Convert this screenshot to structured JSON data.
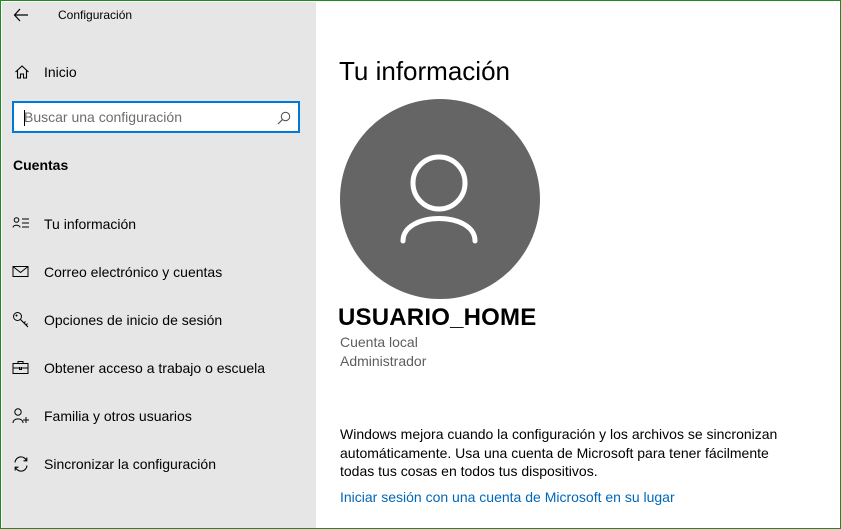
{
  "titlebar": {
    "title": "Configuración",
    "back_icon": "back-arrow-icon"
  },
  "sidebar": {
    "home_label": "Inicio",
    "search_placeholder": "Buscar una configuración",
    "section_title": "Cuentas",
    "items": [
      {
        "label": "Tu información",
        "icon": "person-card-icon"
      },
      {
        "label": "Correo electrónico y cuentas",
        "icon": "mail-icon"
      },
      {
        "label": "Opciones de inicio de sesión",
        "icon": "key-icon"
      },
      {
        "label": "Obtener acceso a trabajo o escuela",
        "icon": "briefcase-icon"
      },
      {
        "label": "Familia y otros usuarios",
        "icon": "add-person-icon"
      },
      {
        "label": "Sincronizar la configuración",
        "icon": "sync-icon"
      }
    ]
  },
  "main": {
    "page_title": "Tu información",
    "username": "USUARIO_HOME",
    "account_type": "Cuenta local",
    "account_role": "Administrador",
    "info_text": "Windows mejora cuando la configuración y los archivos se sincronizan automáticamente. Usa una cuenta de Microsoft para tener fácilmente todas tus cosas en todos tus dispositivos.",
    "link_text": "Iniciar sesión con una cuenta de Microsoft en su lugar"
  },
  "colors": {
    "sidebar_bg": "#e6e6e6",
    "accent": "#0078d7",
    "link": "#0067b8",
    "avatar_bg": "#656565",
    "window_border": "#1f8a1f"
  }
}
